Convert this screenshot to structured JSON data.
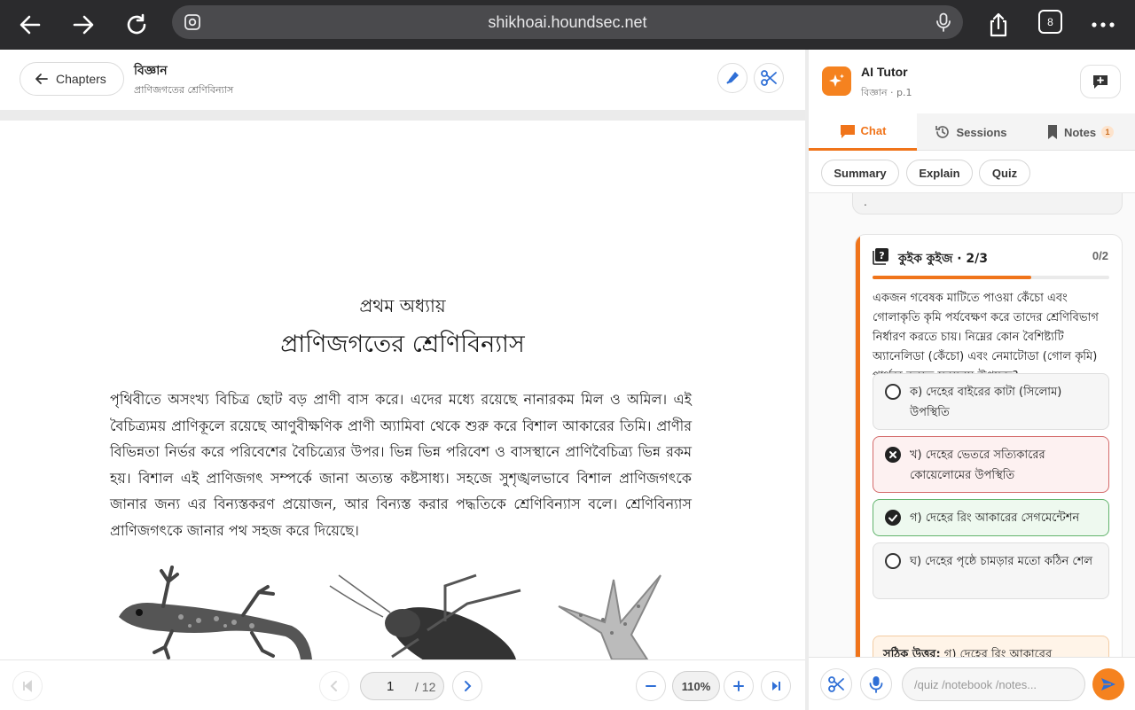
{
  "browser": {
    "url": "shikhoai.houndsec.net",
    "tab_count": "8"
  },
  "reader": {
    "back_label": "Chapters",
    "title": "বিজ্ঞান",
    "subtitle": "প্রাণিজগতের শ্রেণিবিন্যাস",
    "page": {
      "chapter_label": "প্রথম অধ্যায়",
      "chapter_title": "প্রাণিজগতের শ্রেণিবিন্যাস",
      "body": "পৃথিবীতে অসংখ্য বিচিত্র ছোট বড় প্রাণী বাস করে। এদের মধ্যে রয়েছে নানারকম মিল ও অমিল। এই বৈচিত্র্যময় প্রাণিকূলে রয়েছে আণুবীক্ষণিক প্রাণী অ্যামিবা থেকে শুরু করে বিশাল আকারের তিমি। প্রাণীর বিভিন্নতা নির্ভর করে পরিবেশের বৈচিত্র্যের উপর। ভিন্ন ভিন্ন পরিবেশ ও বাসস্থানে প্রাণিবৈচিত্র্য ভিন্ন রকম হয়। বিশাল এই প্রাণিজগৎ সম্পর্কে জানা অত্যন্ত কষ্টসাধ্য। সহজে সুশৃঙ্খলভাবে বিশাল প্রাণিজগৎকে জানার জন্য এর বিন্যস্তকরণ প্রয়োজন, আর বিন্যস্ত করার পদ্ধতিকে শ্রেণিবিন্যাস বলে। শ্রেণিবিন্যাস প্রাণিজগৎকে জানার পথ সহজ করে দিয়েছে।"
    },
    "pager": {
      "current_page": "1",
      "total_pages": "/ 12",
      "zoom": "110%"
    }
  },
  "tutor": {
    "title": "AI Tutor",
    "subtitle": "বিজ্ঞান · p.1",
    "tabs": [
      {
        "label": "Chat",
        "icon": "chat-bubble-icon",
        "active": true
      },
      {
        "label": "Sessions",
        "icon": "history-icon",
        "active": false
      },
      {
        "label": "Notes",
        "icon": "bookmark-icon",
        "active": false,
        "badge": "1"
      }
    ],
    "quick_actions": [
      "Summary",
      "Explain",
      "Quiz"
    ],
    "prev_message_tail": ".",
    "quiz": {
      "title": "কুইক কুইজ · 2/3",
      "score": "0/2",
      "progress": 0.67,
      "question": "একজন গবেষক মাটিতে পাওয়া কেঁচো এবং গোলাকৃতি কৃমি পর্যবেক্ষণ করে তাদের শ্রেণিবিভাগ নির্ধারণ করতে চায়। নিম্নের কোন বৈশিষ্ট্যটি অ্যানেলিডা (কেঁচো) এবং নেমাটোডা (গোল কৃমি) পার্থক্য করতে সবচেয়ে উপযুক্ত?",
      "options": [
        {
          "text": "ক) দেহের বাইরের কাটা (সিলোম) উপস্থিতি",
          "state": "neutral"
        },
        {
          "text": "খ) দেহের ভেতরে সত্যিকারের কোয়েলোমের উপস্থিতি",
          "state": "wrong"
        },
        {
          "text": "গ) দেহের রিং আকারের সেগমেন্টেশন",
          "state": "correct"
        },
        {
          "text": "ঘ) দেহের পৃষ্ঠে চামড়ার মতো কঠিন শেল",
          "state": "neutral"
        }
      ],
      "answer_label": "সঠিক উত্তর:",
      "answer_text": "গ) দেহের রিং আকারের"
    },
    "input_placeholder": "/quiz /notebook /notes..."
  },
  "colors": {
    "accent": "#f0741a",
    "browser_bar": "#2b2b2d",
    "wrong": "#d46a6a",
    "correct": "#61b36c"
  }
}
